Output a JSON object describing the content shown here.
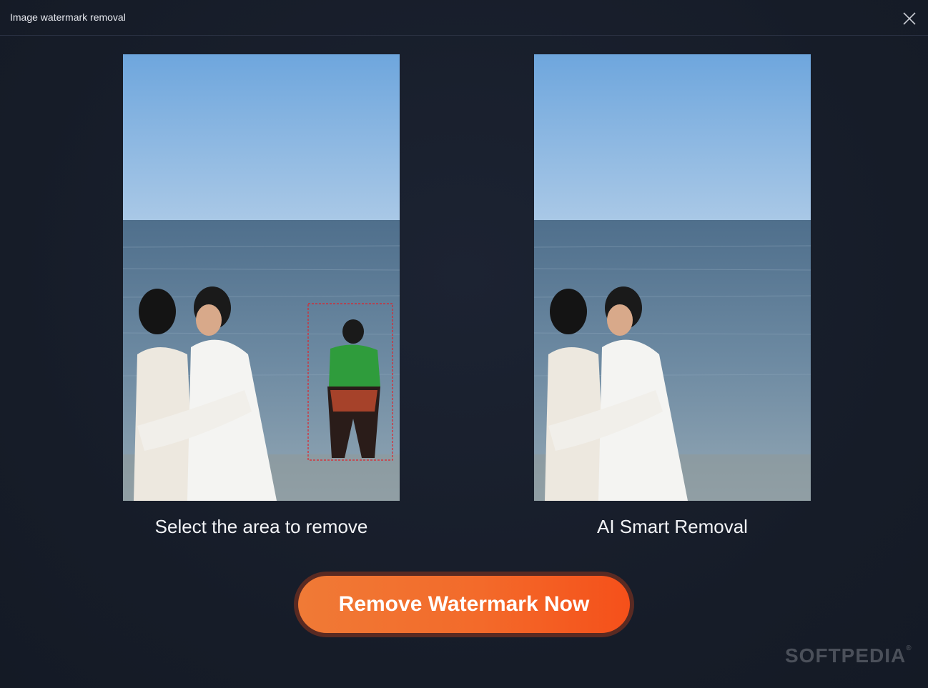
{
  "window": {
    "title": "Image watermark removal",
    "close_icon": "close-icon"
  },
  "panels": {
    "before": {
      "caption": "Select the area to remove",
      "image": "beach-couple-with-bystander-photo",
      "selection_color": "#e0222a"
    },
    "after": {
      "caption": "AI Smart Removal",
      "image": "beach-couple-cleaned-photo"
    }
  },
  "cta": {
    "label": "Remove Watermark Now",
    "color_start": "#f07a36",
    "color_end": "#f5501a"
  },
  "watermark": {
    "text": "SOFTPEDIA",
    "mark": "®"
  }
}
